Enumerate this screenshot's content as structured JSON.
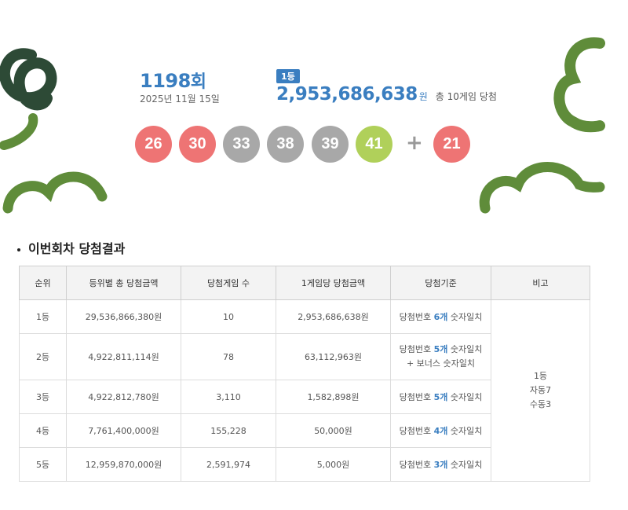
{
  "draw": {
    "round_number": "1198",
    "round_suffix": "회",
    "date": "2025년 11월 15일",
    "first_rank_badge": "1등",
    "first_prize_amount": "2,953,686,638",
    "first_prize_unit": "원",
    "first_prize_winners": "총 10게임 당첨",
    "balls": [
      {
        "number": "26",
        "color": "#ee7474"
      },
      {
        "number": "30",
        "color": "#ee7474"
      },
      {
        "number": "33",
        "color": "#a8a8a8"
      },
      {
        "number": "38",
        "color": "#a8a8a8"
      },
      {
        "number": "39",
        "color": "#a8a8a8"
      },
      {
        "number": "41",
        "color": "#b0d05a"
      }
    ],
    "plus_symbol": "+",
    "bonus_ball": {
      "number": "21",
      "color": "#ee7474"
    }
  },
  "results": {
    "section_title": "이번회차 당첨결과",
    "headers": [
      "순위",
      "등위별 총 당첨금액",
      "당첨게임 수",
      "1게임당 당첨금액",
      "당첨기준",
      "비고"
    ],
    "rows": [
      {
        "rank": "1등",
        "total": "29,536,866,380원",
        "games": "10",
        "per_game": "2,953,686,638원",
        "crit_pre": "당첨번호 ",
        "crit_bold": "6개",
        "crit_post": " 숫자일치",
        "crit_line2": ""
      },
      {
        "rank": "2등",
        "total": "4,922,811,114원",
        "games": "78",
        "per_game": "63,112,963원",
        "crit_pre": "당첨번호 ",
        "crit_bold": "5개",
        "crit_post": " 숫자일치",
        "crit_line2": "+ 보너스 숫자일치"
      },
      {
        "rank": "3등",
        "total": "4,922,812,780원",
        "games": "3,110",
        "per_game": "1,582,898원",
        "crit_pre": "당첨번호 ",
        "crit_bold": "5개",
        "crit_post": " 숫자일치",
        "crit_line2": ""
      },
      {
        "rank": "4등",
        "total": "7,761,400,000원",
        "games": "155,228",
        "per_game": "50,000원",
        "crit_pre": "당첨번호 ",
        "crit_bold": "4개",
        "crit_post": " 숫자일치",
        "crit_line2": ""
      },
      {
        "rank": "5등",
        "total": "12,959,870,000원",
        "games": "2,591,974",
        "per_game": "5,000원",
        "crit_pre": "당첨번호 ",
        "crit_bold": "3개",
        "crit_post": " 숫자일치",
        "crit_line2": ""
      }
    ],
    "note": [
      "1등",
      "자동7",
      "수동3"
    ]
  },
  "colors": {
    "accent": "#3a7ec0",
    "deco_green": "#5f8c3a",
    "deco_dark": "#2d4a36"
  }
}
